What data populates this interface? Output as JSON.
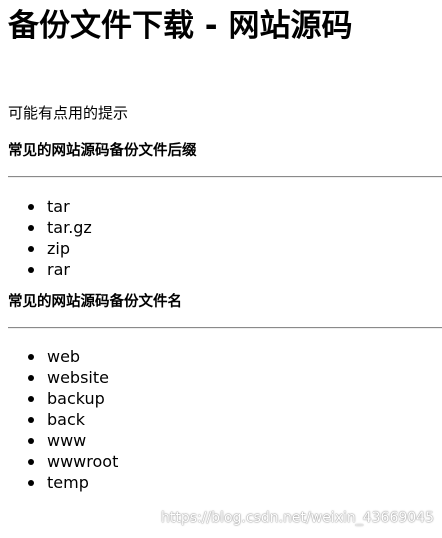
{
  "title": "备份文件下载 - 网站源码",
  "hint": "可能有点用的提示",
  "sections": [
    {
      "heading": "常见的网站源码备份文件后缀",
      "items": [
        "tar",
        "tar.gz",
        "zip",
        "rar"
      ]
    },
    {
      "heading": "常见的网站源码备份文件名",
      "items": [
        "web",
        "website",
        "backup",
        "back",
        "www",
        "wwwroot",
        "temp"
      ]
    }
  ],
  "watermark": "https://blog.csdn.net/weixin_43669045"
}
